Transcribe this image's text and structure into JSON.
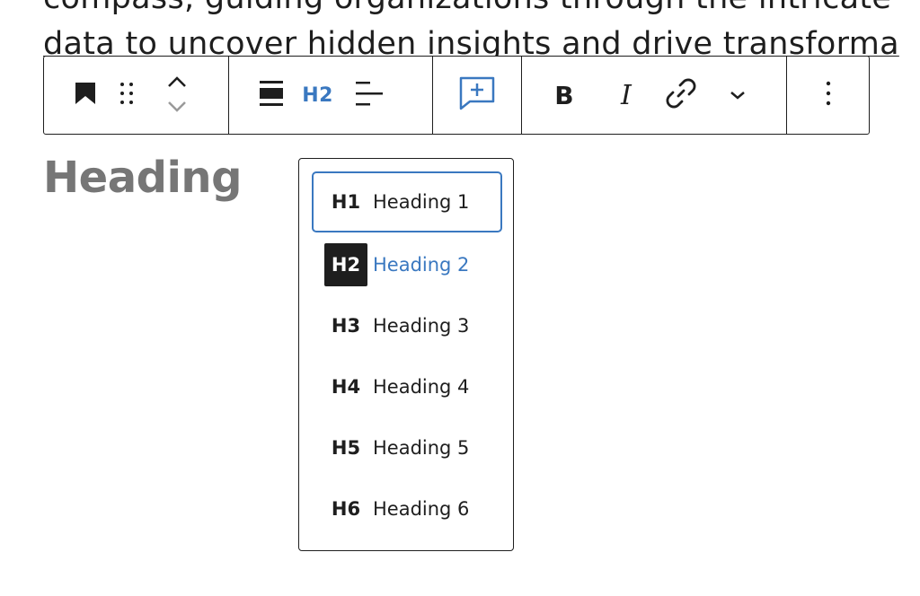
{
  "paragraph": {
    "line1": "compass, guiding organizations through the intricate",
    "line2": "data to uncover hidden insights and drive transforma"
  },
  "toolbar": {
    "block_icon": "bookmark-icon",
    "drag_icon": "drag-handle-icon",
    "move_up_icon": "chevron-up-icon",
    "move_down_icon": "chevron-down-icon",
    "align_icon": "align-wide-icon",
    "heading_level": "H2",
    "text_align_icon": "text-align-icon",
    "comment_icon": "add-comment-icon",
    "bold": "B",
    "italic": "I",
    "link_icon": "link-icon",
    "more_icon": "chevron-down-icon",
    "options_icon": "more-vertical-icon"
  },
  "heading_block": {
    "placeholder": "Heading"
  },
  "heading_menu": {
    "items": [
      {
        "code": "H1",
        "label": "Heading 1",
        "focused": true,
        "active": false
      },
      {
        "code": "H2",
        "label": "Heading 2",
        "focused": false,
        "active": true
      },
      {
        "code": "H3",
        "label": "Heading 3",
        "focused": false,
        "active": false
      },
      {
        "code": "H4",
        "label": "Heading 4",
        "focused": false,
        "active": false
      },
      {
        "code": "H5",
        "label": "Heading 5",
        "focused": false,
        "active": false
      },
      {
        "code": "H6",
        "label": "Heading 6",
        "focused": false,
        "active": false
      }
    ]
  },
  "colors": {
    "accent": "#3a78c0",
    "text": "#1e1e1e",
    "placeholder": "#767676",
    "border": "#1e1e1e"
  }
}
